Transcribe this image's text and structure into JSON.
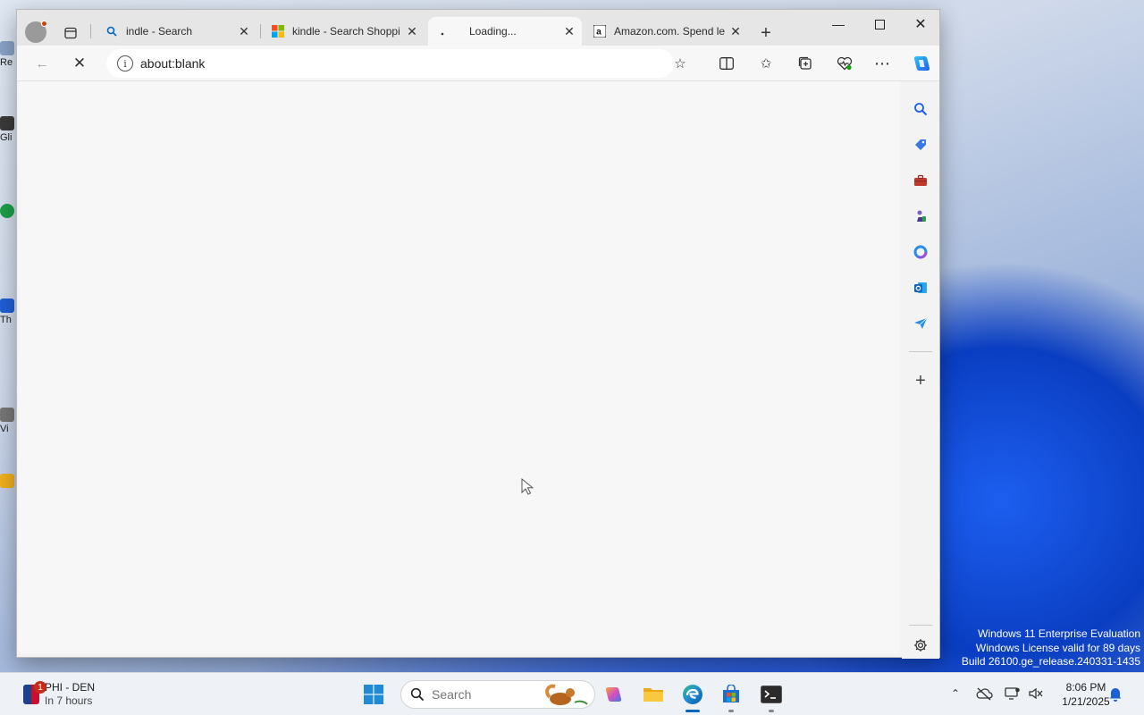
{
  "browser": {
    "tabs": [
      {
        "title": "indle - Search",
        "favicon": "search-icon"
      },
      {
        "title": "kindle - Search Shoppi",
        "favicon": "microsoft-icon"
      },
      {
        "title": "Loading...",
        "favicon": "loading-icon",
        "active": true
      },
      {
        "title": "Amazon.com. Spend le",
        "favicon": "amazon-icon"
      }
    ],
    "address": {
      "value": "about:blank"
    }
  },
  "desktop": {
    "icons": [
      "Re",
      "Gli",
      "Th",
      "Vi"
    ]
  },
  "watermark": {
    "line1": "Windows 11 Enterprise Evaluation",
    "line2": "Windows License valid for 89 days",
    "line3": "Build 26100.ge_release.240331-1435"
  },
  "taskbar": {
    "weather_title": "PHI - DEN",
    "weather_subtitle": "In 7 hours",
    "weather_badge": "1",
    "search_placeholder": "Search",
    "time": "8:06 PM",
    "date": "1/21/2025"
  },
  "colors": {
    "accent": "#0067c0",
    "edge": "#1f8ad6"
  }
}
